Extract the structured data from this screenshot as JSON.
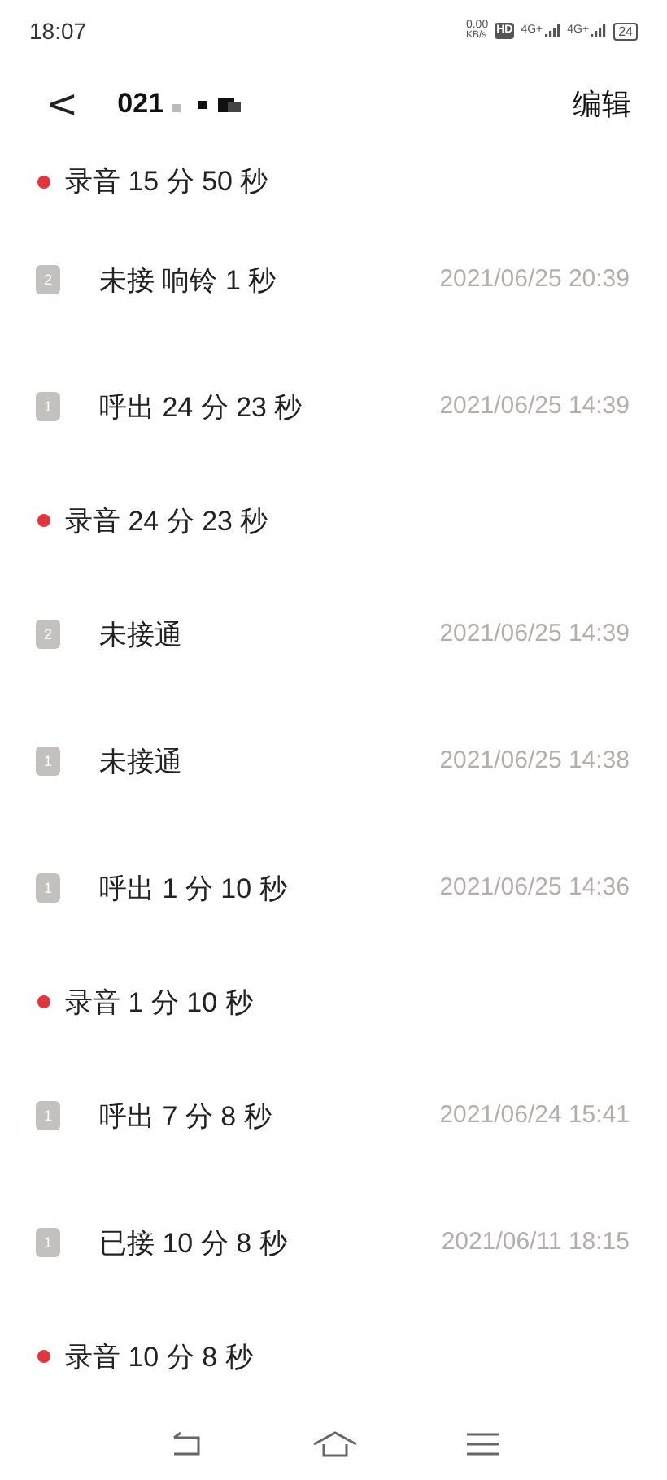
{
  "status_bar": {
    "time": "18:07",
    "speed_value": "0.00",
    "speed_unit": "KB/s",
    "hd": "HD",
    "signals": [
      "4G+",
      "4G+"
    ],
    "battery": "24"
  },
  "header": {
    "back": "<",
    "title": "021",
    "action": "编辑"
  },
  "entries": [
    {
      "kind": "recording",
      "label": "录音 15 分 50 秒"
    },
    {
      "kind": "call",
      "sim": "2",
      "label": "未接 响铃 1 秒",
      "time": "2021/06/25 20:39"
    },
    {
      "kind": "call",
      "sim": "1",
      "label": "呼出 24 分 23 秒",
      "time": "2021/06/25 14:39"
    },
    {
      "kind": "recording",
      "label": "录音 24 分 23 秒"
    },
    {
      "kind": "call",
      "sim": "2",
      "label": "未接通",
      "time": "2021/06/25 14:39"
    },
    {
      "kind": "call",
      "sim": "1",
      "label": "未接通",
      "time": "2021/06/25 14:38"
    },
    {
      "kind": "call",
      "sim": "1",
      "label": "呼出 1 分 10 秒",
      "time": "2021/06/25 14:36"
    },
    {
      "kind": "recording",
      "label": "录音 1 分 10 秒"
    },
    {
      "kind": "call",
      "sim": "1",
      "label": "呼出 7 分 8 秒",
      "time": "2021/06/24 15:41"
    },
    {
      "kind": "call",
      "sim": "1",
      "label": "已接 10 分 8 秒",
      "time": "2021/06/11 18:15"
    },
    {
      "kind": "recording",
      "label": "录音 10 分 8 秒"
    }
  ]
}
